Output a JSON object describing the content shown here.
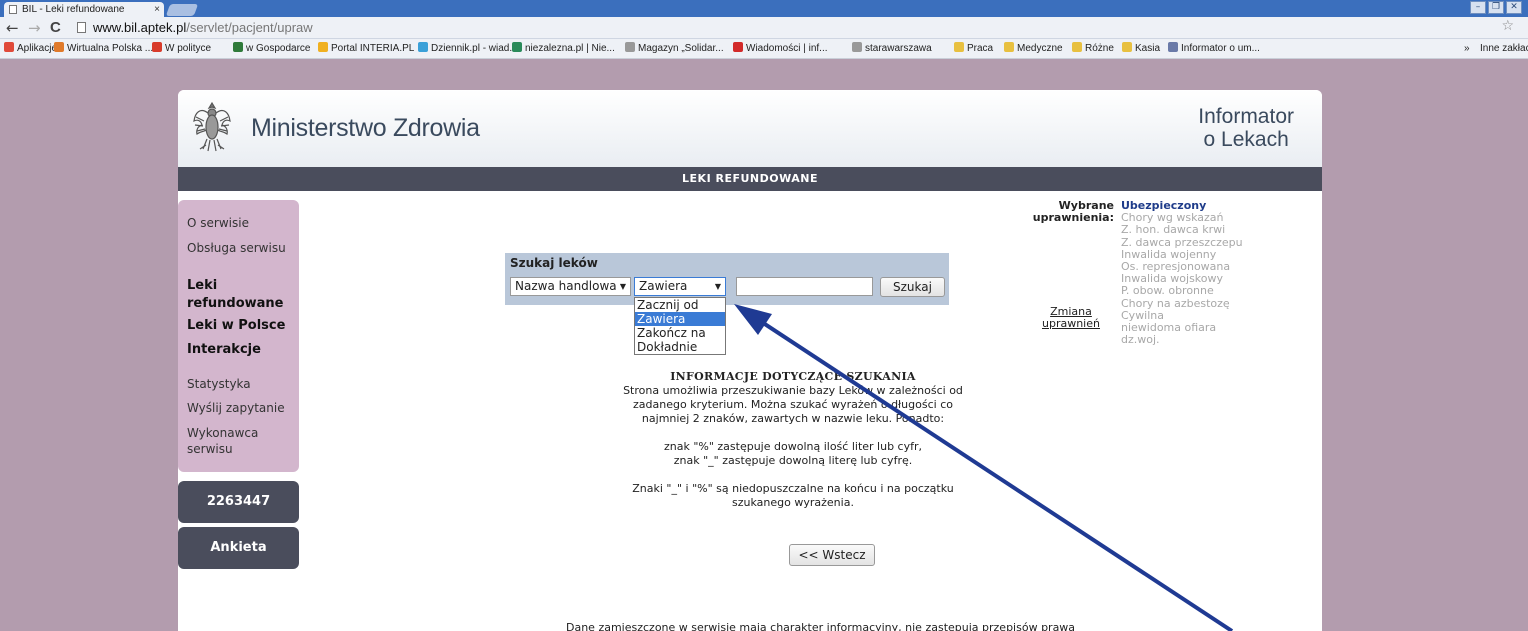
{
  "browser": {
    "tab_title": "BIL - Leki refundowane",
    "tab_close": "×",
    "url_host": "www.bil.aptek.pl",
    "url_path": "/servlet/pacjent/upraw",
    "nav": {
      "back": "←",
      "forward": "→",
      "reload": "C"
    },
    "star": "☆",
    "window_buttons": [
      "–",
      "❐",
      "✕"
    ],
    "bookmarks": [
      {
        "label": "Aplikacje",
        "color": "#e04a3a"
      },
      {
        "label": "Wirtualna Polska ...",
        "color": "#e07a2a"
      },
      {
        "label": "W polityce",
        "color": "#d83b2b"
      },
      {
        "label": "w Gospodarce",
        "color": "#2f7a3a"
      },
      {
        "label": "Portal INTERIA.PL",
        "color": "#f0b020"
      },
      {
        "label": "Dziennik.pl - wiad...",
        "color": "#3aa0d8"
      },
      {
        "label": "niezalezna.pl | Nie...",
        "color": "#2a8a5a"
      },
      {
        "label": "Magazyn „Solidar...",
        "color": "#999999"
      },
      {
        "label": "Wiadomości | inf...",
        "color": "#d22a2a"
      },
      {
        "label": "starawarszawa",
        "color": "#999999"
      },
      {
        "label": "Praca",
        "color": "#e8c040"
      },
      {
        "label": "Medyczne",
        "color": "#e8c040"
      },
      {
        "label": "Różne",
        "color": "#e8c040"
      },
      {
        "label": "Kasia",
        "color": "#e8c040"
      },
      {
        "label": "Informator o um...",
        "color": "#6a7aa8"
      }
    ],
    "bookmarks_more": "»",
    "bookmarks_other": "Inne zakłac"
  },
  "header": {
    "ministry": "Ministerstwo Zdrowia",
    "informator_line1": "Informator",
    "informator_line2": "o Lekach"
  },
  "title_bar": "LEKI REFUNDOWANE",
  "sidebar": {
    "items": [
      "O serwisie",
      "Obsługa serwisu",
      "Leki refundowane",
      "Leki w Polsce",
      "Interakcje",
      "Statystyka",
      "Wyślij zapytanie",
      "Wykonawca serwisu"
    ],
    "counter": "2263447",
    "survey": "Ankieta"
  },
  "search": {
    "title": "Szukaj leków",
    "field_select": "Nazwa handlowa",
    "mode_select": "Zawiera",
    "query_value": "",
    "button": "Szukaj",
    "mode_options": [
      "Zacznij od",
      "Zawiera",
      "Zakończ na",
      "Dokładnie"
    ],
    "mode_selected_index": 1
  },
  "info": {
    "title": "INFORMACJE DOTYCZĄCE SZUKANIA",
    "p1": "Strona umożliwia przeszukiwanie bazy Leków w zależności od zadanego kryterium. Można szukać wyrażeń o długości co najmniej 2 znaków, zawartych w nazwie leku. Ponadto:",
    "p2": "znak \"%\" zastępuje dowolną ilość liter lub cyfr,",
    "p3": "znak \"_\" zastępuje dowolną literę lub cyfrę.",
    "p4": "Znaki \"_\" i \"%\" są niedopuszczalne na końcu i na początku szukanego wyrażenia.",
    "back_button": "<< Wstecz"
  },
  "permissions": {
    "heading": "Wybrane uprawnienia:",
    "change_link": "Zmiana uprawnień",
    "items": [
      "Ubezpieczony",
      "Chory wg wskazań",
      "Z. hon. dawca krwi",
      "Z. dawca przeszczepu",
      "Inwalida wojenny",
      "Os. represjonowana",
      "Inwalida wojskowy",
      "P. obow. obronne",
      "Chory na azbestozę",
      "Cywilna niewidoma ofiara dz.woj."
    ]
  },
  "footer": "Dane zamieszczone w serwisie mają charakter informacyjny, nie zastępują przepisów prawa",
  "colors": {
    "page_bg": "#b39cae",
    "title_bar": "#4a4d5c",
    "sidebar": "#d3b6cd",
    "search_box": "#b9c7d9",
    "arrow": "#1f3a93",
    "selected_option": "#3a7bd5"
  }
}
